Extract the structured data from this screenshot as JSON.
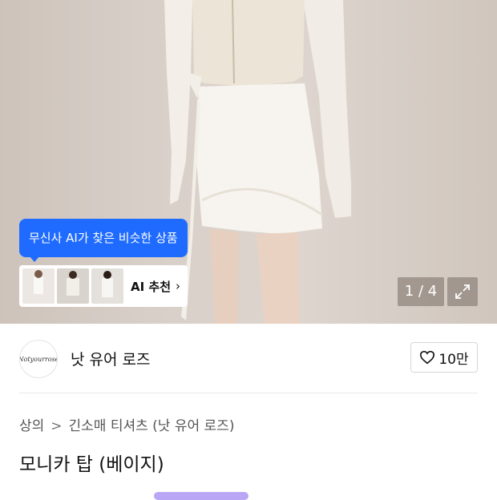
{
  "hero": {
    "ai_tooltip": "무신사 AI가 찾은 비슷한 상품",
    "ai_recommend_label": "AI 추천",
    "chevron": "›",
    "image_counter": "1 / 4",
    "expand_icon": "expand-icon"
  },
  "brand": {
    "logo_text": "Notyourrose",
    "name": "낫 유어 로즈",
    "like_count": "10만"
  },
  "breadcrumb": {
    "category": "상의",
    "separator": ">",
    "subcategory": "긴소매 티셔츠 (낫 유어 로즈)"
  },
  "product": {
    "title": "모니카 탑 (베이지)"
  },
  "colors": {
    "accent_blue": "#1f6bff",
    "peek_purple": "#b9a6f5"
  }
}
